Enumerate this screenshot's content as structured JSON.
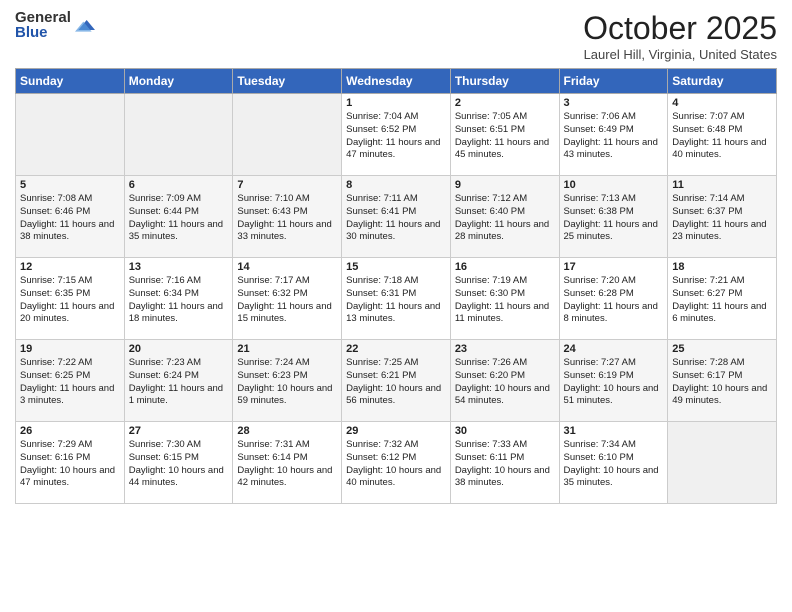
{
  "logo": {
    "general": "General",
    "blue": "Blue"
  },
  "header": {
    "month": "October 2025",
    "location": "Laurel Hill, Virginia, United States"
  },
  "days_of_week": [
    "Sunday",
    "Monday",
    "Tuesday",
    "Wednesday",
    "Thursday",
    "Friday",
    "Saturday"
  ],
  "weeks": [
    [
      {
        "day": "",
        "info": ""
      },
      {
        "day": "",
        "info": ""
      },
      {
        "day": "",
        "info": ""
      },
      {
        "day": "1",
        "info": "Sunrise: 7:04 AM\nSunset: 6:52 PM\nDaylight: 11 hours and 47 minutes."
      },
      {
        "day": "2",
        "info": "Sunrise: 7:05 AM\nSunset: 6:51 PM\nDaylight: 11 hours and 45 minutes."
      },
      {
        "day": "3",
        "info": "Sunrise: 7:06 AM\nSunset: 6:49 PM\nDaylight: 11 hours and 43 minutes."
      },
      {
        "day": "4",
        "info": "Sunrise: 7:07 AM\nSunset: 6:48 PM\nDaylight: 11 hours and 40 minutes."
      }
    ],
    [
      {
        "day": "5",
        "info": "Sunrise: 7:08 AM\nSunset: 6:46 PM\nDaylight: 11 hours and 38 minutes."
      },
      {
        "day": "6",
        "info": "Sunrise: 7:09 AM\nSunset: 6:44 PM\nDaylight: 11 hours and 35 minutes."
      },
      {
        "day": "7",
        "info": "Sunrise: 7:10 AM\nSunset: 6:43 PM\nDaylight: 11 hours and 33 minutes."
      },
      {
        "day": "8",
        "info": "Sunrise: 7:11 AM\nSunset: 6:41 PM\nDaylight: 11 hours and 30 minutes."
      },
      {
        "day": "9",
        "info": "Sunrise: 7:12 AM\nSunset: 6:40 PM\nDaylight: 11 hours and 28 minutes."
      },
      {
        "day": "10",
        "info": "Sunrise: 7:13 AM\nSunset: 6:38 PM\nDaylight: 11 hours and 25 minutes."
      },
      {
        "day": "11",
        "info": "Sunrise: 7:14 AM\nSunset: 6:37 PM\nDaylight: 11 hours and 23 minutes."
      }
    ],
    [
      {
        "day": "12",
        "info": "Sunrise: 7:15 AM\nSunset: 6:35 PM\nDaylight: 11 hours and 20 minutes."
      },
      {
        "day": "13",
        "info": "Sunrise: 7:16 AM\nSunset: 6:34 PM\nDaylight: 11 hours and 18 minutes."
      },
      {
        "day": "14",
        "info": "Sunrise: 7:17 AM\nSunset: 6:32 PM\nDaylight: 11 hours and 15 minutes."
      },
      {
        "day": "15",
        "info": "Sunrise: 7:18 AM\nSunset: 6:31 PM\nDaylight: 11 hours and 13 minutes."
      },
      {
        "day": "16",
        "info": "Sunrise: 7:19 AM\nSunset: 6:30 PM\nDaylight: 11 hours and 11 minutes."
      },
      {
        "day": "17",
        "info": "Sunrise: 7:20 AM\nSunset: 6:28 PM\nDaylight: 11 hours and 8 minutes."
      },
      {
        "day": "18",
        "info": "Sunrise: 7:21 AM\nSunset: 6:27 PM\nDaylight: 11 hours and 6 minutes."
      }
    ],
    [
      {
        "day": "19",
        "info": "Sunrise: 7:22 AM\nSunset: 6:25 PM\nDaylight: 11 hours and 3 minutes."
      },
      {
        "day": "20",
        "info": "Sunrise: 7:23 AM\nSunset: 6:24 PM\nDaylight: 11 hours and 1 minute."
      },
      {
        "day": "21",
        "info": "Sunrise: 7:24 AM\nSunset: 6:23 PM\nDaylight: 10 hours and 59 minutes."
      },
      {
        "day": "22",
        "info": "Sunrise: 7:25 AM\nSunset: 6:21 PM\nDaylight: 10 hours and 56 minutes."
      },
      {
        "day": "23",
        "info": "Sunrise: 7:26 AM\nSunset: 6:20 PM\nDaylight: 10 hours and 54 minutes."
      },
      {
        "day": "24",
        "info": "Sunrise: 7:27 AM\nSunset: 6:19 PM\nDaylight: 10 hours and 51 minutes."
      },
      {
        "day": "25",
        "info": "Sunrise: 7:28 AM\nSunset: 6:17 PM\nDaylight: 10 hours and 49 minutes."
      }
    ],
    [
      {
        "day": "26",
        "info": "Sunrise: 7:29 AM\nSunset: 6:16 PM\nDaylight: 10 hours and 47 minutes."
      },
      {
        "day": "27",
        "info": "Sunrise: 7:30 AM\nSunset: 6:15 PM\nDaylight: 10 hours and 44 minutes."
      },
      {
        "day": "28",
        "info": "Sunrise: 7:31 AM\nSunset: 6:14 PM\nDaylight: 10 hours and 42 minutes."
      },
      {
        "day": "29",
        "info": "Sunrise: 7:32 AM\nSunset: 6:12 PM\nDaylight: 10 hours and 40 minutes."
      },
      {
        "day": "30",
        "info": "Sunrise: 7:33 AM\nSunset: 6:11 PM\nDaylight: 10 hours and 38 minutes."
      },
      {
        "day": "31",
        "info": "Sunrise: 7:34 AM\nSunset: 6:10 PM\nDaylight: 10 hours and 35 minutes."
      },
      {
        "day": "",
        "info": ""
      }
    ]
  ]
}
